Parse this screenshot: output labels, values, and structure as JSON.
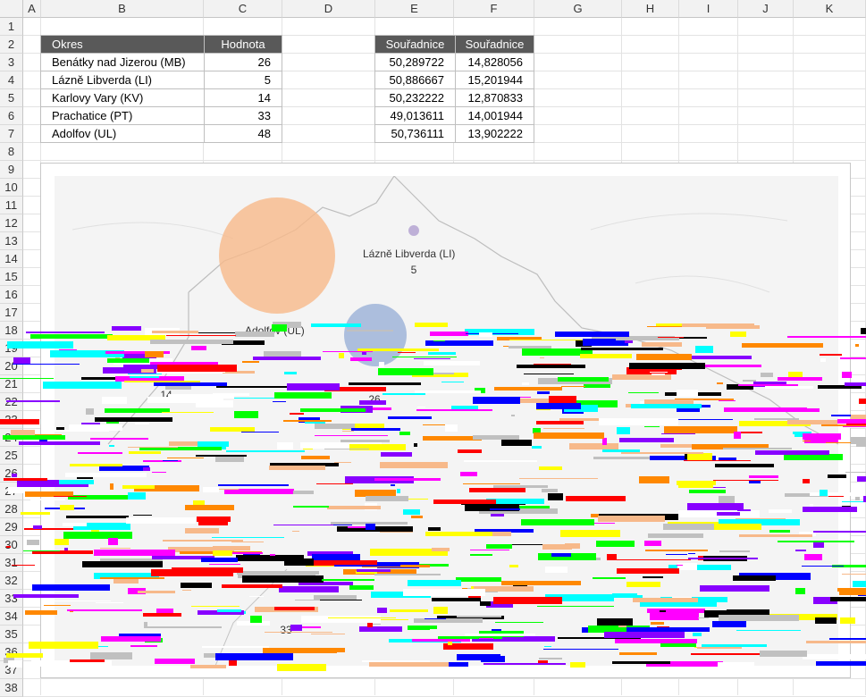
{
  "columns": [
    "A",
    "B",
    "C",
    "D",
    "E",
    "F",
    "G",
    "H",
    "I",
    "J",
    "K"
  ],
  "rows": [
    "1",
    "2",
    "3",
    "4",
    "5",
    "6",
    "7",
    "8",
    "9",
    "10",
    "11",
    "12",
    "13",
    "14",
    "15",
    "16",
    "17",
    "18",
    "19",
    "20",
    "21",
    "22",
    "23",
    "24",
    "25",
    "26",
    "27",
    "28",
    "29",
    "30",
    "31",
    "32",
    "33",
    "34",
    "35",
    "36",
    "37",
    "38"
  ],
  "table1": {
    "headers": [
      "Okres",
      "Hodnota"
    ],
    "rows": [
      [
        "Benátky nad Jizerou (MB)",
        "26"
      ],
      [
        "Lázně Libverda (LI)",
        "5"
      ],
      [
        "Karlovy Vary (KV)",
        "14"
      ],
      [
        "Prachatice (PT)",
        "33"
      ],
      [
        "Adolfov (UL)",
        "48"
      ]
    ]
  },
  "table2": {
    "headers": [
      "Souřadnice",
      "Souřadnice"
    ],
    "rows": [
      [
        "50,289722",
        "14,828056"
      ],
      [
        "50,886667",
        "15,201944"
      ],
      [
        "50,232222",
        "12,870833"
      ],
      [
        "49,013611",
        "14,001944"
      ],
      [
        "50,736111",
        "13,902222"
      ]
    ]
  },
  "map": {
    "labels": {
      "libverda": "Lázně Libverda (LI)",
      "libverda_val": "5",
      "adolfov": "Adolfov (UL)",
      "karlovy_val": "14",
      "benatky_val": "26",
      "prachatice_val": "33"
    },
    "colors": {
      "orange": "#f7b98a",
      "blue": "#9fb4d8",
      "purple": "#b8a9d4"
    }
  }
}
